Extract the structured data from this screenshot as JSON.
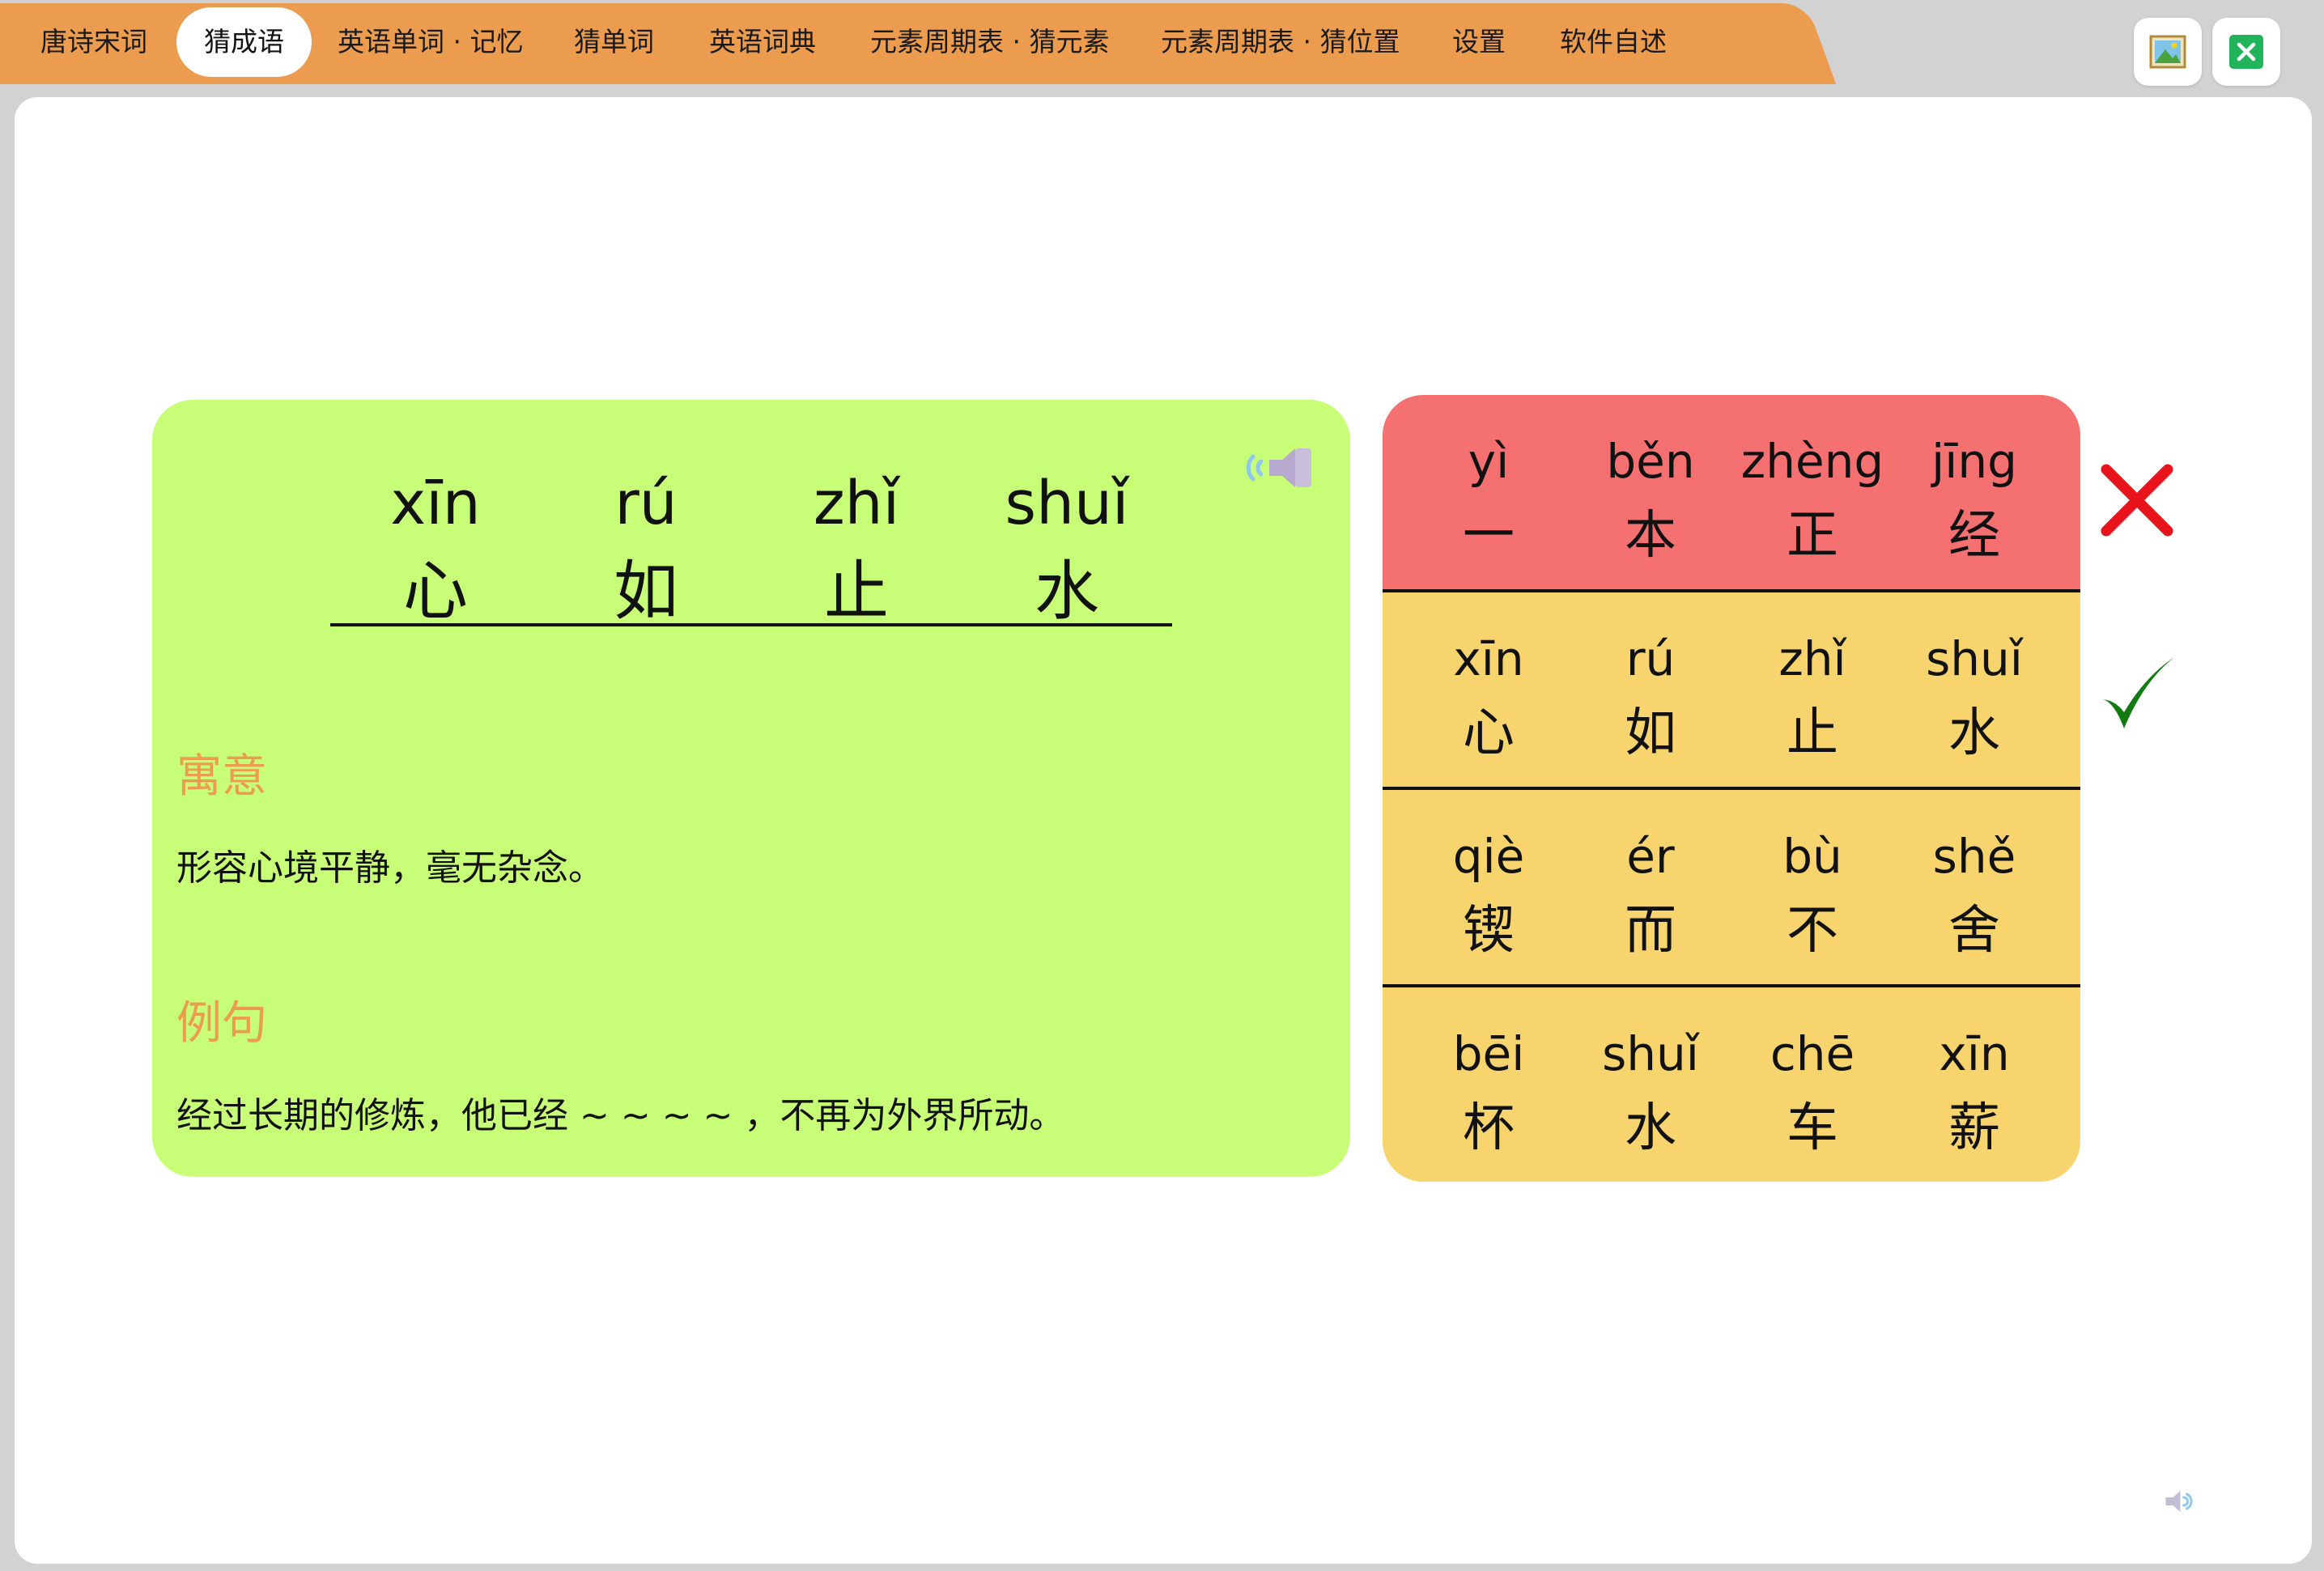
{
  "tabs": [
    {
      "label": "唐诗宋词",
      "active": false
    },
    {
      "label": "猜成语",
      "active": true
    },
    {
      "label": "英语单词 · 记忆",
      "active": false
    },
    {
      "label": "猜单词",
      "active": false
    },
    {
      "label": "英语词典",
      "active": false
    },
    {
      "label": "元素周期表 · 猜元素",
      "active": false
    },
    {
      "label": "元素周期表 · 猜位置",
      "active": false
    },
    {
      "label": "设置",
      "active": false
    },
    {
      "label": "软件自述",
      "active": false
    }
  ],
  "window_buttons": {
    "image": "image-icon",
    "close": "close-icon"
  },
  "idiom": {
    "pinyin": [
      "xīn",
      "rú",
      "zhǐ",
      "shuǐ"
    ],
    "chars": [
      "心",
      "如",
      "止",
      "水"
    ],
    "meaning_heading": "寓意",
    "meaning": "形容心境平静，毫无杂念。",
    "example_heading": "例句",
    "example": "经过长期的修炼，他已经 ~ ~ ~ ~ ，不再为外界所动。"
  },
  "options": [
    {
      "pinyin": [
        "yì",
        "běn",
        "zhèng",
        "jīng"
      ],
      "chars": [
        "一",
        "本",
        "正",
        "经"
      ],
      "status": "wrong"
    },
    {
      "pinyin": [
        "xīn",
        "rú",
        "zhǐ",
        "shuǐ"
      ],
      "chars": [
        "心",
        "如",
        "止",
        "水"
      ],
      "status": "correct"
    },
    {
      "pinyin": [
        "qiè",
        "ér",
        "bù",
        "shě"
      ],
      "chars": [
        "锲",
        "而",
        "不",
        "舍"
      ],
      "status": ""
    },
    {
      "pinyin": [
        "bēi",
        "shuǐ",
        "chē",
        "xīn"
      ],
      "chars": [
        "杯",
        "水",
        "车",
        "薪"
      ],
      "status": ""
    }
  ],
  "colors": {
    "tabbar": "#eb9c4f",
    "card": "#c8fd78",
    "option": "#f7d46d",
    "wrong_option": "#f57171",
    "wrong_mark": "#e8141c",
    "correct_mark": "#117a11"
  }
}
